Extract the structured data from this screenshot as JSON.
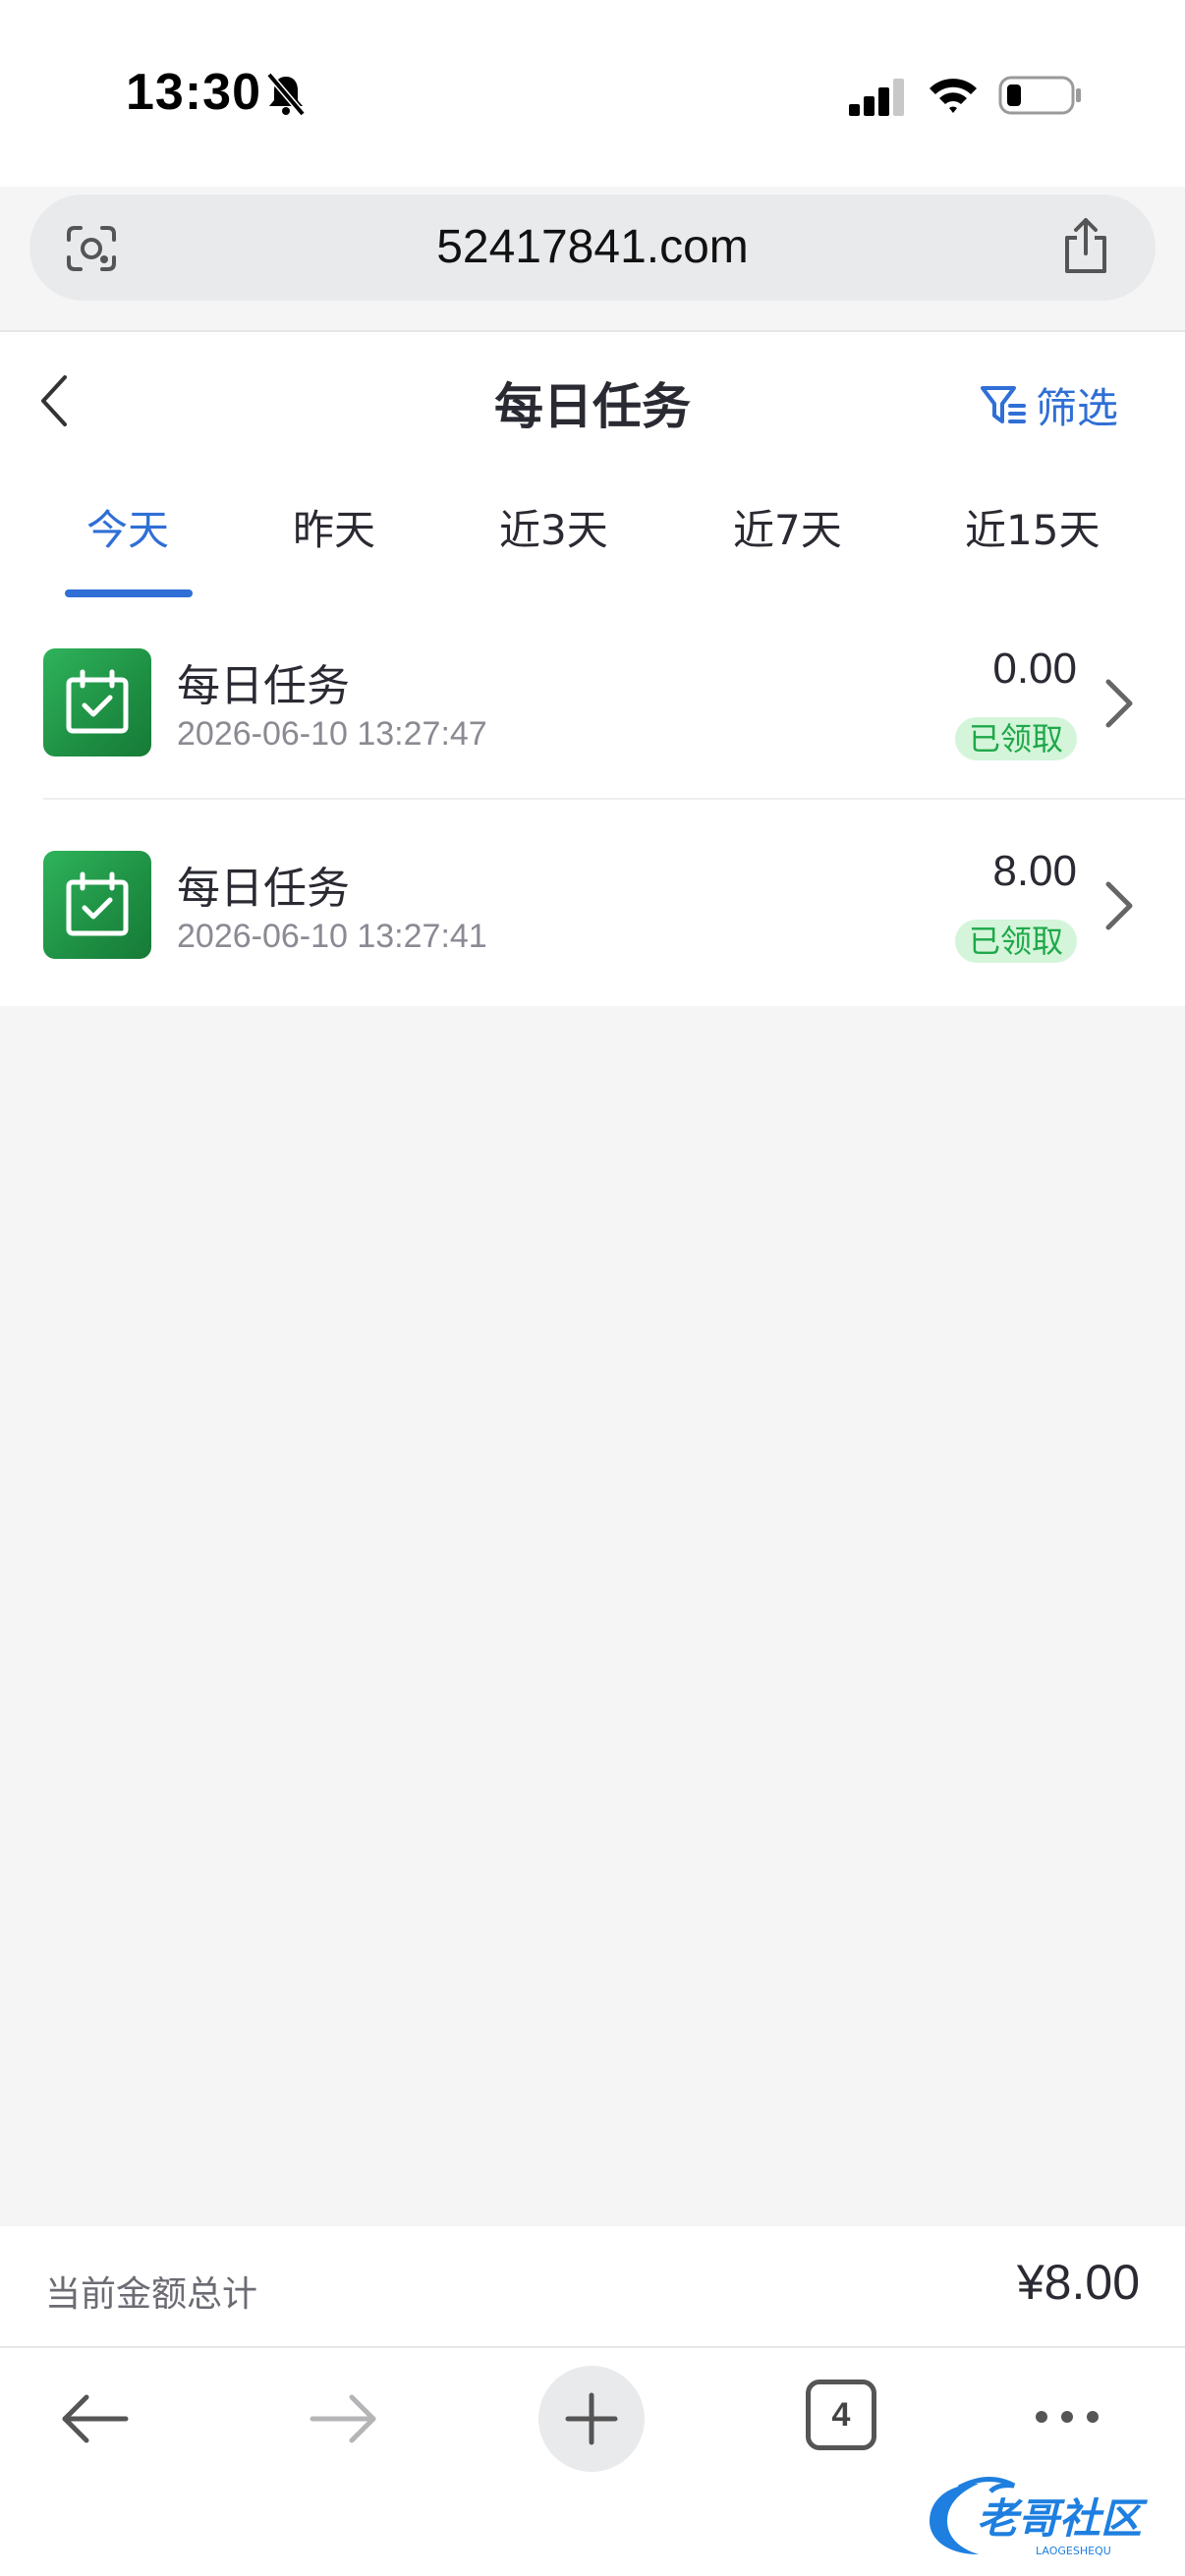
{
  "status_bar": {
    "time": "13:30"
  },
  "browser": {
    "url": "52417841.com",
    "open_tabs_count": "4"
  },
  "header": {
    "title": "每日任务",
    "filter_label": "筛选"
  },
  "tabs": [
    {
      "label": "今天",
      "active": true
    },
    {
      "label": "昨天",
      "active": false
    },
    {
      "label": "近3天",
      "active": false
    },
    {
      "label": "近7天",
      "active": false
    },
    {
      "label": "近15天",
      "active": false
    }
  ],
  "records": [
    {
      "title": "每日任务",
      "time": "2026-06-10 13:27:47",
      "amount": "0.00",
      "status": "已领取"
    },
    {
      "title": "每日任务",
      "time": "2026-06-10 13:27:41",
      "amount": "8.00",
      "status": "已领取"
    }
  ],
  "footer": {
    "total_label": "当前金额总计",
    "total_value": "¥8.00"
  },
  "watermark": {
    "name": "老哥社区",
    "subtitle": "LAOGESHEQU"
  },
  "colors": {
    "accent": "#2f6fd6",
    "badge_bg": "#d4f5d9",
    "badge_text": "#1fa84a",
    "icon_green": "#1e8f43"
  }
}
